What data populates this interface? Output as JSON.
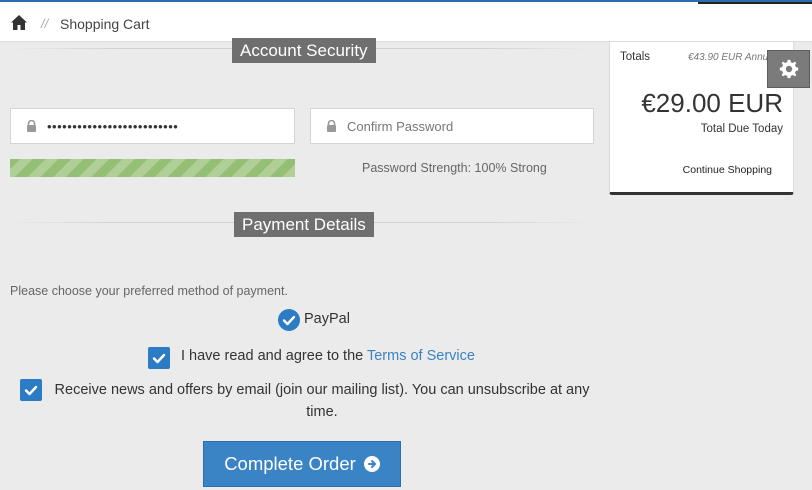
{
  "breadcrumb": {
    "separator": "//",
    "current": "Shopping Cart"
  },
  "account_security": {
    "title": "Account Security",
    "password_value": "••••••••••••••••••••••••••",
    "confirm_placeholder": "Confirm Password",
    "strength_text": "Password Strength: 100% Strong",
    "strength_percent": 100
  },
  "payment": {
    "title": "Payment Details",
    "prompt": "Please choose your preferred method of payment.",
    "method_label": "PayPal",
    "method_selected": true,
    "tos_text": "I have read and agree to the ",
    "tos_link": "Terms of Service",
    "tos_checked": true,
    "newsletter_text": "Receive news and offers by email (join our mailing list). You can unsubscribe at any time.",
    "newsletter_checked": true,
    "complete_button": "Complete Order"
  },
  "totals": {
    "label": "Totals",
    "annual": "€43.90 EUR Annually",
    "amount": "€29.00 EUR",
    "due_label": "Total Due Today",
    "continue_link": "Continue Shopping"
  },
  "colors": {
    "accent": "#3a84c6",
    "check_blue": "#2c7bc4",
    "strength_green": "#94bf74",
    "section_title_bg": "#6f6f6f"
  },
  "icons": {
    "home": "home-icon",
    "lock": "lock-icon",
    "check": "check-icon",
    "arrow": "arrow-circle-right-icon",
    "gear": "gear-icon"
  }
}
